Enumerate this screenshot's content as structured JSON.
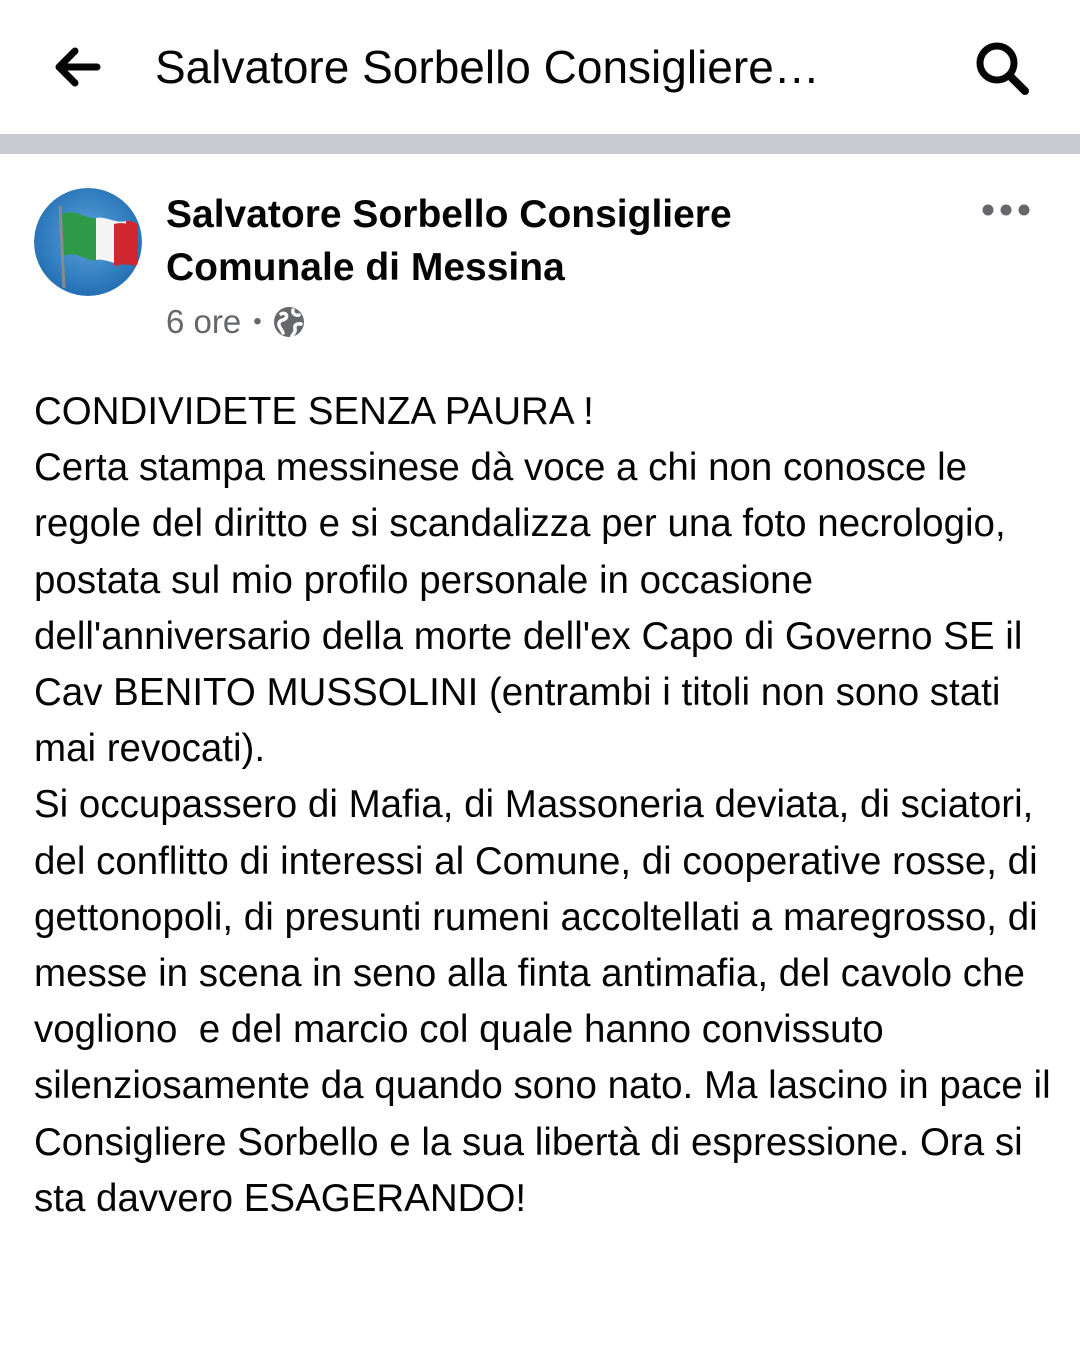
{
  "topbar": {
    "title": "Salvatore Sorbello Consigliere…",
    "back_icon": "arrow-left-icon",
    "search_icon": "search-icon"
  },
  "post": {
    "author": "Salvatore Sorbello Consigliere Comunale di Messina",
    "avatar_icon": "italian-flag-avatar",
    "time": "6 ore",
    "separator": "•",
    "privacy_icon": "globe-icon",
    "more_icon": "more-horizontal-icon",
    "paragraphs": [
      "CONDIVIDETE SENZA PAURA !",
      "Certa stampa messinese dà voce a chi non conosce le regole del diritto e si scandalizza per una foto necrologio, postata sul mio profilo personale in occasione dell'anniversario della morte dell'ex Capo di Governo SE il Cav BENITO MUSSOLINI (entrambi i titoli non sono stati mai revocati).",
      "Si occupassero di Mafia, di Massoneria deviata, di sciatori, del conflitto di interessi al Comune, di cooperative rosse, di gettonopoli, di presunti rumeni accoltellati a maregrosso, di messe in scena in seno alla finta antimafia, del cavolo che vogliono  e del marcio col quale hanno convissuto silenziosamente da quando sono nato. Ma lascino in pace il Consigliere Sorbello e la sua libertà di espressione. Ora si sta davvero ESAGERANDO!"
    ]
  },
  "colors": {
    "text": "#050505",
    "secondary_text": "#65676b",
    "divider": "#c9ccd1",
    "flag_green": "#2e9a48",
    "flag_white": "#f4f4f4",
    "flag_red": "#d0262f",
    "avatar_sky": "#2f7fc4"
  }
}
